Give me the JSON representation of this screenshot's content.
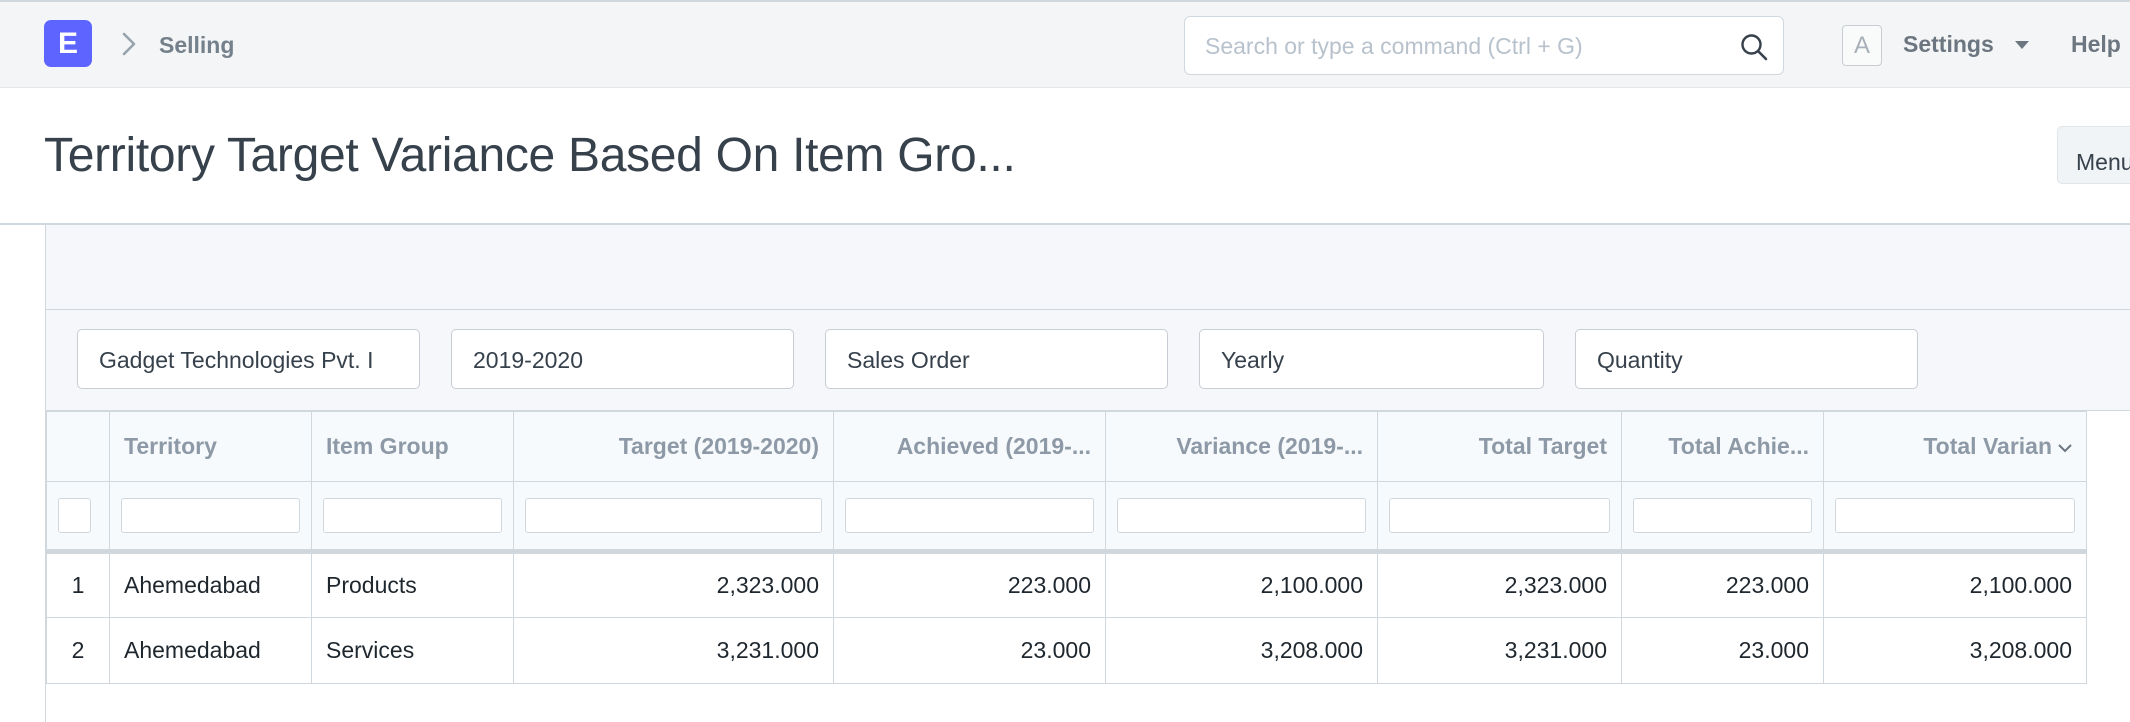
{
  "navbar": {
    "logo_letter": "E",
    "breadcrumb": "Selling",
    "search_placeholder": "Search or type a command (Ctrl + G)",
    "avatar_letter": "A",
    "settings_label": "Settings",
    "help_label": "Help"
  },
  "page": {
    "title": "Territory Target Variance Based On Item Gro...",
    "menu_label": "Menu"
  },
  "filters": [
    "Gadget Technologies Pvt. I",
    "2019-2020",
    "Sales Order",
    "Yearly",
    "Quantity"
  ],
  "table": {
    "columns": [
      "Territory",
      "Item Group",
      "Target (2019-2020)",
      "Achieved (2019-...",
      "Variance (2019-...",
      "Total Target",
      "Total Achie...",
      "Total Varian"
    ],
    "rows": [
      [
        "1",
        "Ahemedabad",
        "Products",
        "2,323.000",
        "223.000",
        "2,100.000",
        "2,323.000",
        "223.000",
        "2,100.000"
      ],
      [
        "2",
        "Ahemedabad",
        "Services",
        "3,231.000",
        "23.000",
        "3,208.000",
        "3,231.000",
        "23.000",
        "3,208.000"
      ]
    ]
  }
}
